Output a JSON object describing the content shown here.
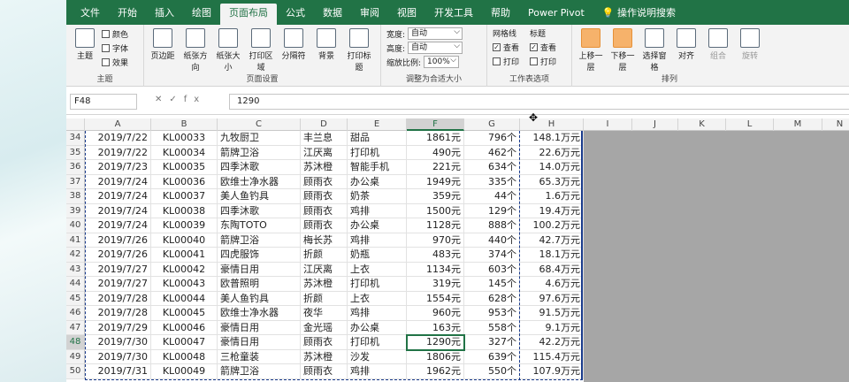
{
  "tabs": [
    "文件",
    "开始",
    "插入",
    "绘图",
    "页面布局",
    "公式",
    "数据",
    "审阅",
    "视图",
    "开发工具",
    "帮助",
    "Power Pivot",
    "操作说明搜索"
  ],
  "active_tab": "页面布局",
  "ribbon": {
    "theme": {
      "main": "主题",
      "colors": "颜色",
      "fonts": "字体",
      "effects": "效果",
      "label": "主题"
    },
    "page_setup": {
      "buttons": [
        "页边距",
        "纸张方向",
        "纸张大小",
        "打印区域",
        "分隔符",
        "背景",
        "打印标题"
      ],
      "label": "页面设置"
    },
    "scale": {
      "width_label": "宽度:",
      "width_val": "自动",
      "height_label": "高度:",
      "height_val": "自动",
      "zoom_label": "缩放比例:",
      "zoom_val": "100%",
      "label": "调整为合适大小"
    },
    "sheet_opts": {
      "gridlines": "网格线",
      "headings": "标题",
      "view": "查看",
      "print": "打印",
      "label": "工作表选项"
    },
    "arrange": {
      "buttons": [
        "上移一层",
        "下移一层",
        "选择窗格",
        "对齐",
        "组合",
        "旋转"
      ],
      "label": "排列"
    }
  },
  "formula_bar": {
    "name_box": "F48",
    "fx": "fx",
    "value": "1290"
  },
  "columns": [
    "A",
    "B",
    "C",
    "D",
    "E",
    "F",
    "G",
    "H",
    "I",
    "J",
    "K",
    "L",
    "M",
    "N"
  ],
  "rows": [
    [
      "34",
      "2019/7/22",
      "KL00033",
      "九牧厨卫",
      "丰兰息",
      "甜品",
      "1861元",
      "796个",
      "148.1万元"
    ],
    [
      "35",
      "2019/7/22",
      "KL00034",
      "箭牌卫浴",
      "江厌离",
      "打印机",
      "490元",
      "462个",
      "22.6万元"
    ],
    [
      "36",
      "2019/7/23",
      "KL00035",
      "四季沐歌",
      "苏沐橙",
      "智能手机",
      "221元",
      "634个",
      "14.0万元"
    ],
    [
      "37",
      "2019/7/24",
      "KL00036",
      "欧维士净水器",
      "顾雨衣",
      "办公桌",
      "1949元",
      "335个",
      "65.3万元"
    ],
    [
      "38",
      "2019/7/24",
      "KL00037",
      "美人鱼钓具",
      "顾雨衣",
      "奶茶",
      "359元",
      "44个",
      "1.6万元"
    ],
    [
      "39",
      "2019/7/24",
      "KL00038",
      "四季沐歌",
      "顾雨衣",
      "鸡排",
      "1500元",
      "129个",
      "19.4万元"
    ],
    [
      "40",
      "2019/7/24",
      "KL00039",
      "东陶TOTO",
      "顾雨衣",
      "办公桌",
      "1128元",
      "888个",
      "100.2万元"
    ],
    [
      "41",
      "2019/7/26",
      "KL00040",
      "箭牌卫浴",
      "梅长苏",
      "鸡排",
      "970元",
      "440个",
      "42.7万元"
    ],
    [
      "42",
      "2019/7/26",
      "KL00041",
      "四虎服饰",
      "折颜",
      "奶瓶",
      "483元",
      "374个",
      "18.1万元"
    ],
    [
      "43",
      "2019/7/27",
      "KL00042",
      "豪情日用",
      "江厌离",
      "上衣",
      "1134元",
      "603个",
      "68.4万元"
    ],
    [
      "44",
      "2019/7/27",
      "KL00043",
      "欧普照明",
      "苏沐橙",
      "打印机",
      "319元",
      "145个",
      "4.6万元"
    ],
    [
      "45",
      "2019/7/28",
      "KL00044",
      "美人鱼钓具",
      "折颜",
      "上衣",
      "1554元",
      "628个",
      "97.6万元"
    ],
    [
      "46",
      "2019/7/28",
      "KL00045",
      "欧维士净水器",
      "夜华",
      "鸡排",
      "960元",
      "953个",
      "91.5万元"
    ],
    [
      "47",
      "2019/7/29",
      "KL00046",
      "豪情日用",
      "金光瑶",
      "办公桌",
      "163元",
      "558个",
      "9.1万元"
    ],
    [
      "48",
      "2019/7/30",
      "KL00047",
      "豪情日用",
      "顾雨衣",
      "打印机",
      "1290元",
      "327个",
      "42.2万元"
    ],
    [
      "49",
      "2019/7/30",
      "KL00048",
      "三枪童装",
      "苏沐橙",
      "沙发",
      "1806元",
      "639个",
      "115.4万元"
    ],
    [
      "50",
      "2019/7/31",
      "KL00049",
      "箭牌卫浴",
      "顾雨衣",
      "鸡排",
      "1962元",
      "550个",
      "107.9万元"
    ]
  ],
  "active_row": "48",
  "active_col": "F"
}
